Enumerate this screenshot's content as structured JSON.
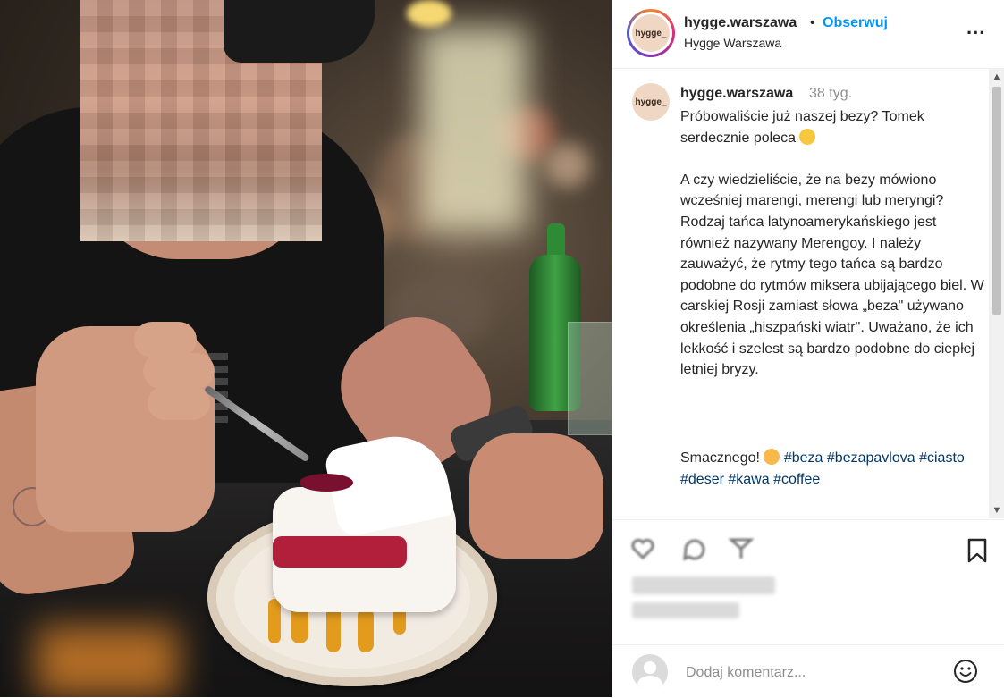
{
  "header": {
    "avatar_text": "hygge_",
    "username": "hygge.warszawa",
    "separator": "•",
    "follow_label": "Obserwuj",
    "location": "Hygge Warszawa",
    "more_label": "..."
  },
  "caption": {
    "avatar_text": "hygge_",
    "username": "hygge.warszawa",
    "time": "38 tyg.",
    "text_line1": "Próbowaliście już naszej bezy? Tomek serdecznie poleca",
    "text_body": "A czy wiedzieliście, że na bezy mówiono wcześniej marengi, merengi lub meryngi?\nRodzaj tańca latynoamerykańskiego jest również nazywany Merengoy. I należy zauważyć, że rytmy tego tańca są bardzo podobne do rytmów miksera ubijającego biel. W carskiej Rosji zamiast słowa „beza\" używano określenia „hiszpański wiatr\". Uważano, że ich lekkość i szelest są bardzo podobne do ciepłej letniej bryzy.",
    "closing": "Smacznego!",
    "hashtags": [
      "#beza",
      "#bezapavlova",
      "#ciasto",
      "#deser",
      "#kawa",
      "#coffee"
    ]
  },
  "comment": {
    "placeholder": "Dodaj komentarz..."
  },
  "icons": {
    "like": "heart-icon",
    "comment": "comment-icon",
    "share": "share-icon",
    "save": "bookmark-icon",
    "emoji": "emoji-icon",
    "more": "more-icon"
  },
  "colors": {
    "follow": "#0095f6",
    "hashtag": "#00376b",
    "muted": "#8e8e8e",
    "text": "#262626"
  }
}
